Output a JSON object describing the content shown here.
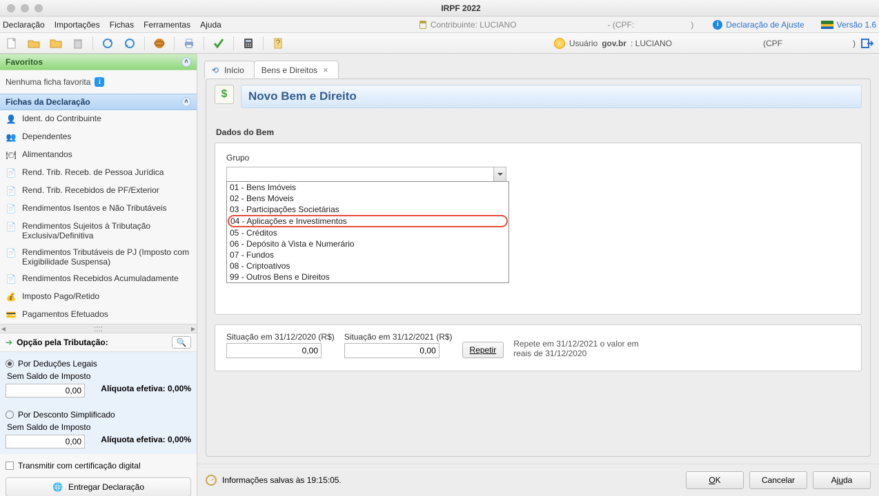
{
  "window_title": "IRPF 2022",
  "menus": {
    "declaracao": "Declaração",
    "importacoes": "Importações",
    "fichas": "Fichas",
    "ferramentas": "Ferramentas",
    "ajuda": "Ajuda"
  },
  "header": {
    "contrib_label": "Contribuinte: LUCIANO",
    "cpf_label": "- (CPF:",
    "cpf_close": ")",
    "ajuste": "Declaração de Ajuste",
    "versao": "Versão 1.6"
  },
  "userstrip": {
    "prefix": "Usuário ",
    "govbr": "gov.br",
    "after": ": LUCIANO",
    "cpf_label": "(CPF",
    "cpf_close": ")"
  },
  "favoritos": {
    "title": "Favoritos",
    "empty": "Nenhuma ficha favorita"
  },
  "fichas_panel_title": "Fichas da Declaração",
  "fichas": [
    {
      "icon": "👤",
      "label": "Ident. do Contribuinte"
    },
    {
      "icon": "👥",
      "label": "Dependentes"
    },
    {
      "icon": "🍽",
      "label": "Alimentandos"
    },
    {
      "icon": "📄",
      "label": "Rend. Trib. Receb. de Pessoa Jurídica"
    },
    {
      "icon": "📄",
      "label": "Rend. Trib. Recebidos de PF/Exterior"
    },
    {
      "icon": "📄",
      "label": "Rendimentos Isentos e Não Tributáveis"
    },
    {
      "icon": "📄",
      "label": "Rendimentos Sujeitos à Tributação Exclusiva/Definitiva"
    },
    {
      "icon": "📄",
      "label": "Rendimentos Tributáveis de PJ (Imposto com Exigibilidade Suspensa)"
    },
    {
      "icon": "📄",
      "label": "Rendimentos Recebidos Acumuladamente"
    },
    {
      "icon": "💰",
      "label": "Imposto Pago/Retido"
    },
    {
      "icon": "💳",
      "label": "Pagamentos Efetuados"
    }
  ],
  "opcao_label": "Opção pela Tributação:",
  "tax": {
    "opt1": "Por Deduções Legais",
    "opt2": "Por Desconto Simplificado",
    "sem_saldo": "Sem Saldo de Imposto",
    "zero": "0,00",
    "aliq_label": "Alíquota efetiva: 0,00%"
  },
  "transmit_label": "Transmitir com certificação digital",
  "deliver_label": "Entregar Declaração",
  "tabs": {
    "inicio": "Início",
    "bens": "Bens e Direitos"
  },
  "card": {
    "title": "Novo Bem e Direito",
    "section": "Dados do Bem",
    "grupo": "Grupo"
  },
  "options": [
    "01 - Bens Imóveis",
    "02 - Bens Móveis",
    "03 - Participações Societárias",
    "04 - Aplicações e Investimentos",
    "05 - Créditos",
    "06 - Depósito à Vista e Numerário",
    "07 - Fundos",
    "08 - Criptoativos",
    "99 - Outros Bens e Direitos"
  ],
  "situ": {
    "l2020": "Situação em 31/12/2020 (R$)",
    "l2021": "Situação em 31/12/2021 (R$)",
    "v2020": "0,00",
    "v2021": "0,00",
    "repetir": "Repetir",
    "info": "Repete em 31/12/2021 o valor em reais de 31/12/2020"
  },
  "footer": {
    "info": "Informações salvas às 19:15:05.",
    "ok": "OK",
    "cancel": "Cancelar",
    "ajuda": "Ajuda"
  }
}
